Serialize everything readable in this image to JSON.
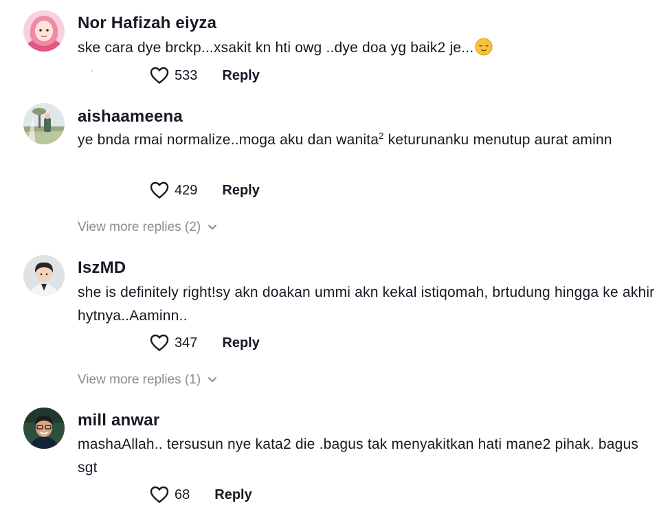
{
  "comments": [
    {
      "username": "Nor Hafizah eiyza",
      "text": "ske cara dye brckp...xsakit kn hti owg ..dye doa yg baik2 je...",
      "emoji": "relieved-face-emoji",
      "likes": "533",
      "reply_label": "Reply"
    },
    {
      "username": "aishaameena",
      "text_before_sup": "ye bnda rmai normalize..moga aku dan wanita",
      "text_sup": "2",
      "text_after_sup": " keturunanku menutup aurat aminn",
      "likes": "429",
      "reply_label": "Reply",
      "view_more": "View more replies (2)"
    },
    {
      "username": "IszMD",
      "text": "she is definitely right!sy akn doakan ummi akn kekal istiqomah, brtudung hingga ke akhir hytnya..Aaminn..",
      "likes": "347",
      "reply_label": "Reply",
      "view_more": "View more replies (1)"
    },
    {
      "username": "mill anwar",
      "text": "mashaAllah.. tersusun nye kata2 die .bagus tak menyakitkan hati mane2 pihak. bagus sgt",
      "likes": "68",
      "reply_label": "Reply"
    }
  ],
  "icons": {
    "like": "heart-outline-icon",
    "expand": "chevron-down-icon"
  },
  "colors": {
    "text": "#161823",
    "muted": "#8a8b91",
    "emoji": "#f7c33a"
  }
}
